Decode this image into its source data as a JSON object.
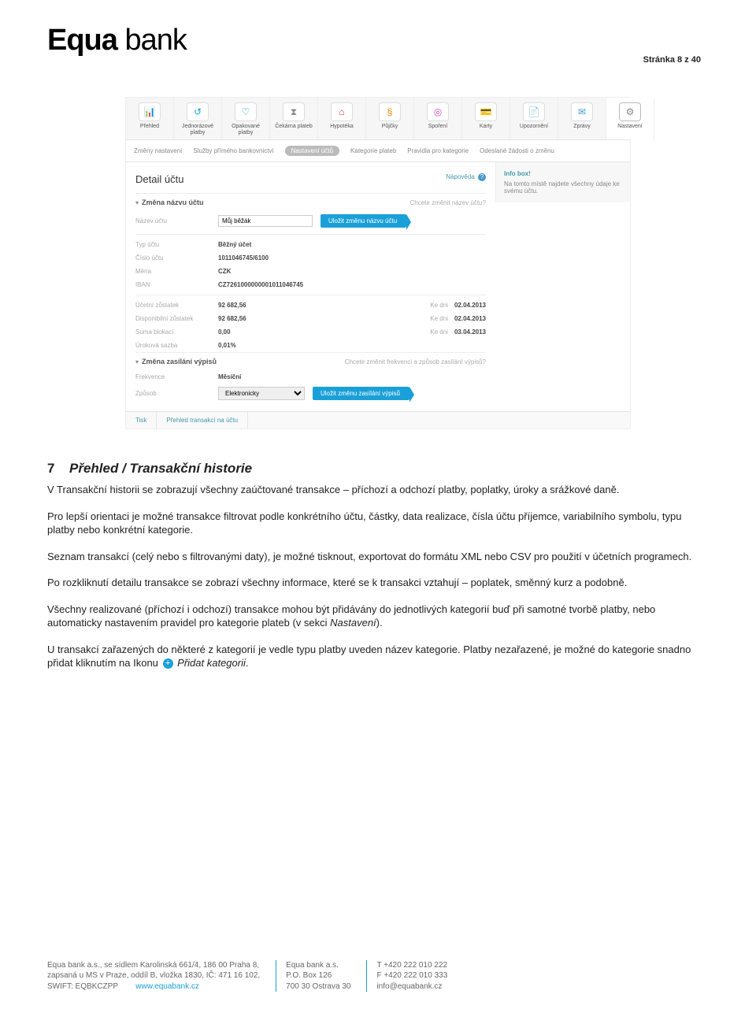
{
  "header": {
    "logo_text": "Equa bank",
    "page_num": "Stránka 8 z 40"
  },
  "tabs": [
    {
      "icon": "📊",
      "label": "Přehled",
      "color": "#1aa0d8"
    },
    {
      "icon": "↺",
      "label": "Jednorázové platby",
      "color": "#1aa0d8"
    },
    {
      "icon": "♡",
      "label": "Opakované platby",
      "color": "#1aa0d8"
    },
    {
      "icon": "⧗",
      "label": "Čekárna plateb",
      "color": "#888"
    },
    {
      "icon": "⌂",
      "label": "Hypotéka",
      "color": "#d33"
    },
    {
      "icon": "§",
      "label": "Půjčky",
      "color": "#e80"
    },
    {
      "icon": "◎",
      "label": "Spoření",
      "color": "#c4c"
    },
    {
      "icon": "💳",
      "label": "Karty",
      "color": "#49c"
    },
    {
      "icon": "📄",
      "label": "Upozornění",
      "color": "#49c"
    },
    {
      "icon": "✉",
      "label": "Zprávy",
      "color": "#49c"
    },
    {
      "icon": "⚙",
      "label": "Nastavení",
      "color": "#888",
      "active": true
    }
  ],
  "subtabs": [
    "Změny nastavení",
    "Služby přímého bankovnictví",
    "Nastavení účtů",
    "Kategorie plateb",
    "Pravidla pro kategorie",
    "Odeslané žádosti o změnu"
  ],
  "subtab_active_index": 2,
  "panel": {
    "title": "Detail účtu",
    "help": "Nápověda",
    "sec1": {
      "head": "Změna názvu účtu",
      "hint": "Chcete změnit název účtu?",
      "btn": "Uložit změnu názvu účtu",
      "name_label": "Název účtu",
      "name_value": "Můj běžák"
    },
    "details": [
      {
        "k": "Typ účtu",
        "v": "Běžný účet"
      },
      {
        "k": "Číslo účtu",
        "v": "1011046745/6100"
      },
      {
        "k": "Měna",
        "v": "CZK"
      },
      {
        "k": "IBAN",
        "v": "CZ7261000000001011046745"
      }
    ],
    "balances": [
      {
        "k": "Účetní zůstatek",
        "v": "92 682,56",
        "d": "Ke dni",
        "dv": "02.04.2013"
      },
      {
        "k": "Disponibilní zůstatek",
        "v": "92 682,56",
        "d": "Ke dni",
        "dv": "02.04.2013"
      },
      {
        "k": "Suma blokací",
        "v": "0,00",
        "d": "Ke dni",
        "dv": "03.04.2013"
      },
      {
        "k": "Úroková sazba",
        "v": "0,01%"
      }
    ],
    "sec2": {
      "head": "Změna zasílání výpisů",
      "hint": "Chcete změnit frekvenci a způsob zasílání výpisů?",
      "btn": "Uložit změnu zasílání výpisů",
      "freq_label": "Frekvence",
      "freq_value": "Měsíční",
      "method_label": "Způsob",
      "method_value": "Elektronicky"
    }
  },
  "infobox": {
    "title": "Info box!",
    "text": "Na tomto místě najdete všechny údaje ke svému účtu."
  },
  "bottombar": [
    "Tisk",
    "Přehled transakcí na účtu"
  ],
  "article": {
    "num": "7",
    "title": "Přehled / Transakční historie",
    "p1": "V Transakční historii se zobrazují všechny zaúčtované transakce – příchozí a odchozí platby, poplatky, úroky a srážkové daně.",
    "p2": "Pro lepší orientaci je možné transakce filtrovat podle konkrétního účtu, částky, data realizace, čísla účtu příjemce, variabilního symbolu, typu platby nebo konkrétní kategorie.",
    "p3": "Seznam transakcí (celý nebo s filtrovanými daty), je možné tisknout, exportovat do formátu XML nebo CSV pro použití v účetních programech.",
    "p4": "Po rozkliknutí detailu transakce se zobrazí všechny informace, které se k transakci vztahují – poplatek, směnný kurz a podobně.",
    "p5a": "Všechny realizované (příchozí i odchozí) transakce mohou být přidávány do jednotlivých kategorií buď při samotné tvorbě platby, nebo automaticky nastavením pravidel pro kategorie plateb (v sekci ",
    "p5b": "Nastavení",
    "p5c": ").",
    "p6a": "U transakcí zařazených do některé z kategorií je vedle typu platby uveden název kategorie. Platby nezařazené, je možné do kategorie snadno přidat kliknutím na Ikonu ",
    "p6b": "Přidat kategorii",
    "p6c": "."
  },
  "footer": {
    "col1": [
      "Equa bank a.s., se sídlem Karolinská 661/4, 186 00 Praha 8,",
      "zapsaná u MS v Praze, oddíl B, vložka 1830, IČ: 471 16 102,",
      "SWIFT: EQBKCZPP"
    ],
    "col1_link": "www.equabank.cz",
    "col2": [
      "Equa bank a.s.",
      "P.O. Box 126",
      "700 30 Ostrava 30"
    ],
    "col3": [
      "T +420 222 010 222",
      "F +420 222 010 333",
      "info@equabank.cz"
    ]
  }
}
